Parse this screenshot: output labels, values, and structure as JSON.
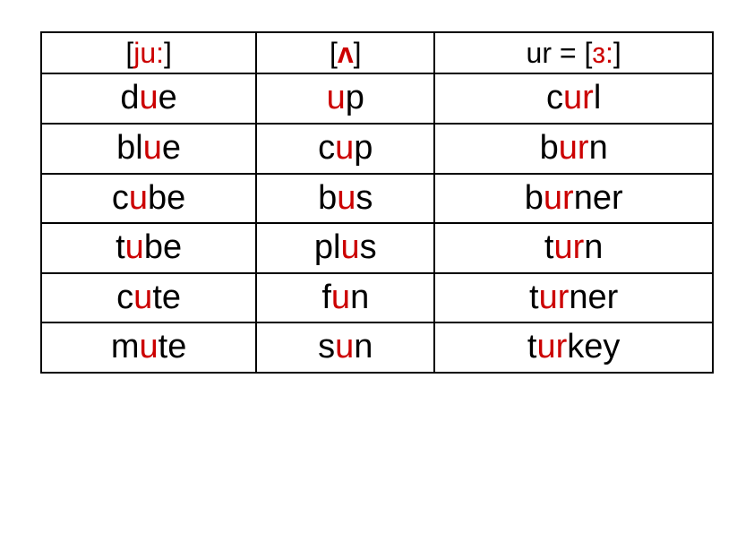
{
  "headers": {
    "col1": {
      "bracket_open": "[",
      "phon": "ju:",
      "bracket_close": "]"
    },
    "col2": {
      "bracket_open": "[",
      "phon": "ʌ",
      "bracket_close": "]"
    },
    "col3": {
      "prefix": "ur = [",
      "phon": "ɜ:",
      "bracket_close": "]"
    }
  },
  "rows": [
    {
      "c1": {
        "pre": "d",
        "hi": "u",
        "post": "e"
      },
      "c2": {
        "pre": "",
        "hi": "u",
        "post": "p"
      },
      "c3": {
        "pre": "c",
        "hi": "ur",
        "post": "l"
      }
    },
    {
      "c1": {
        "pre": "bl",
        "hi": "u",
        "post": "e"
      },
      "c2": {
        "pre": "c",
        "hi": "u",
        "post": "p"
      },
      "c3": {
        "pre": "b",
        "hi": "ur",
        "post": "n"
      }
    },
    {
      "c1": {
        "pre": "c",
        "hi": "u",
        "post": "be"
      },
      "c2": {
        "pre": "b",
        "hi": "u",
        "post": "s"
      },
      "c3": {
        "pre": "b",
        "hi": "ur",
        "post": "ner"
      }
    },
    {
      "c1": {
        "pre": "t",
        "hi": "u",
        "post": "be"
      },
      "c2": {
        "pre": "pl",
        "hi": "u",
        "post": "s"
      },
      "c3": {
        "pre": "t",
        "hi": "ur",
        "post": "n"
      }
    },
    {
      "c1": {
        "pre": "c",
        "hi": "u",
        "post": "te"
      },
      "c2": {
        "pre": "f",
        "hi": "u",
        "post": "n"
      },
      "c3": {
        "pre": "t",
        "hi": "ur",
        "post": "ner"
      }
    },
    {
      "c1": {
        "pre": "m",
        "hi": "u",
        "post": "te"
      },
      "c2": {
        "pre": "s",
        "hi": "u",
        "post": "n"
      },
      "c3": {
        "pre": "t",
        "hi": "ur",
        "post": "key"
      }
    }
  ]
}
